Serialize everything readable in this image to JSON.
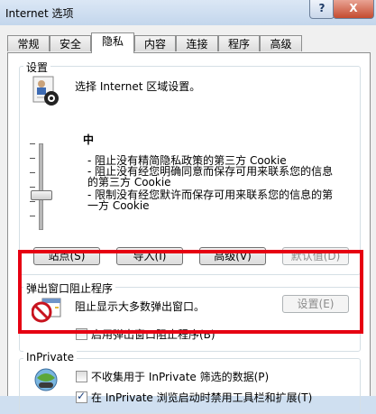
{
  "window": {
    "title": "Internet 选项",
    "help_label": "?",
    "close_label": "X"
  },
  "tabs": [
    {
      "label": "常规"
    },
    {
      "label": "安全"
    },
    {
      "label": "隐私"
    },
    {
      "label": "内容"
    },
    {
      "label": "连接"
    },
    {
      "label": "程序"
    },
    {
      "label": "高级"
    }
  ],
  "active_tab": "隐私",
  "settings": {
    "group_label": "设置",
    "prompt": "选择 Internet 区域设置。",
    "level": "中",
    "descriptions": [
      "- 阻止没有精简隐私政策的第三方 Cookie",
      "- 阻止没有经您明确同意而保存可用来联系您的信息",
      "的第三方 Cookie",
      "- 限制没有经您默许而保存可用来联系您的信息的第",
      "一方 Cookie"
    ],
    "buttons": {
      "sites": "站点(S)",
      "import": "导入(I)",
      "advanced": "高级(V)",
      "default": "默认值(D)"
    }
  },
  "popup_blocker": {
    "group_label": "弹出窗口阻止程序",
    "description": "阻止显示大多数弹出窗口。",
    "settings_button": "设置(E)",
    "enable_label": "启用弹出窗口阻止程序(B)",
    "enabled": false
  },
  "inprivate": {
    "group_label": "InPrivate",
    "option1_label": "不收集用于 InPrivate 筛选的数据(P)",
    "option1_checked": false,
    "option2_label": "在 InPrivate 浏览启动时禁用工具栏和扩展(T)",
    "option2_checked": true
  },
  "colors": {
    "highlight": "#e60012",
    "titlebar": "#c3d6ec"
  }
}
